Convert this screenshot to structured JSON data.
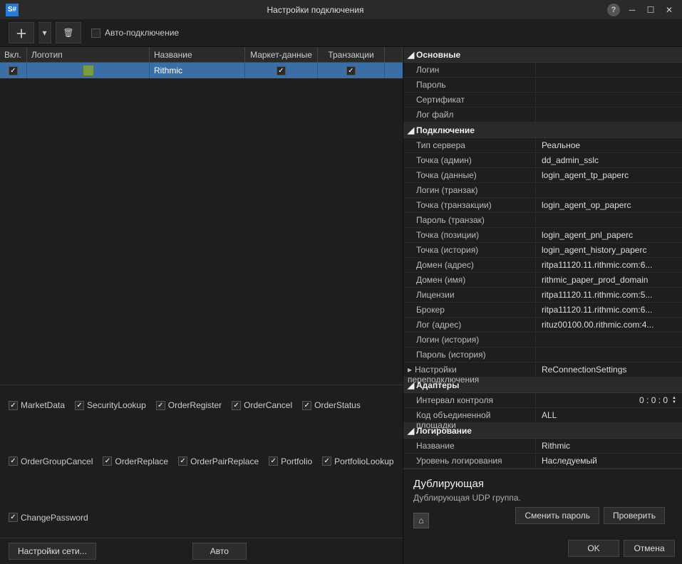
{
  "title": "Настройки подключения",
  "app_icon_text": "S#",
  "toolbar": {
    "auto_connect_label": "Авто-подключение",
    "auto_connect_checked": false
  },
  "grid": {
    "headers": {
      "vkl": "Вкл.",
      "logo": "Логотип",
      "name": "Название",
      "market": "Маркет-данные",
      "trans": "Транзакции"
    },
    "row": {
      "name": "Rithmic"
    }
  },
  "checkboxes": [
    "MarketData",
    "SecurityLookup",
    "OrderRegister",
    "OrderCancel",
    "OrderStatus",
    "OrderGroupCancel",
    "OrderReplace",
    "OrderPairReplace",
    "Portfolio",
    "PortfolioLookup",
    "ChangePassword"
  ],
  "props": {
    "sec_main": "Основные",
    "login": "Логин",
    "password": "Пароль",
    "cert": "Сертификат",
    "logfile": "Лог файл",
    "sec_conn": "Подключение",
    "server_type": "Тип сервера",
    "server_type_val": "Реальное",
    "admin_point": "Точка (админ)",
    "admin_point_val": "dd_admin_sslc",
    "data_point": "Точка (данные)",
    "data_point_val": "login_agent_tp_paperc",
    "login_trans": "Логин (транзак)",
    "trans_point": "Точка (транзакции)",
    "trans_point_val": "login_agent_op_paperc",
    "pwd_trans": "Пароль (транзак)",
    "pos_point": "Точка (позиции)",
    "pos_point_val": "login_agent_pnl_paperc",
    "hist_point": "Точка (история)",
    "hist_point_val": "login_agent_history_paperc",
    "domain_addr": "Домен (адрес)",
    "domain_addr_val": "ritpa11120.11.rithmic.com:6...",
    "domain_name": "Домен (имя)",
    "domain_name_val": "rithmic_paper_prod_domain",
    "licenses": "Лицензии",
    "licenses_val": "ritpa11120.11.rithmic.com:5...",
    "broker": "Брокер",
    "broker_val": "ritpa11120.11.rithmic.com:6...",
    "log_addr": "Лог (адрес)",
    "log_addr_val": "rituz00100.00.rithmic.com:4...",
    "login_hist": "Логин (история)",
    "pwd_hist": "Пароль (история)",
    "reconn": "Настройки переподключения",
    "reconn_val": "ReConnectionSettings",
    "sec_adapters": "Адаптеры",
    "interval": "Интервал контроля",
    "interval_val": "0 : 0 : 0",
    "board_code": "Код объединенной площадки",
    "board_code_val": "ALL",
    "sec_log": "Логирование",
    "log_name": "Название",
    "log_name_val": "Rithmic",
    "log_level": "Уровень логирования",
    "log_level_val": "Наследуемый"
  },
  "desc": {
    "title": "Дублирующая",
    "text": "Дублирующая UDP группа."
  },
  "buttons": {
    "change_pwd": "Сменить пароль",
    "check": "Проверить",
    "ok": "OK",
    "cancel": "Отмена",
    "net_settings": "Настройки сети...",
    "auto": "Авто"
  }
}
